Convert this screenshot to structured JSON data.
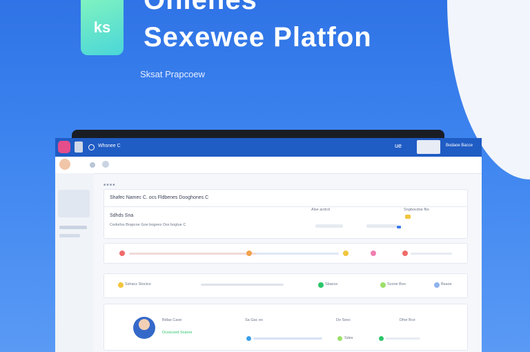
{
  "hero": {
    "logo_text": "ks",
    "title_line1": "Onlenes",
    "title_line2": "Sexewee Platfon",
    "tagline": "Sksat Prapcoew"
  },
  "app": {
    "window_title": "Whsnee C",
    "header_right": "ue",
    "header_stat": "Bodaoe Bacce",
    "panel_header": "Shafec Namec C. ocs Fldbenes Dooghones C",
    "row1_label": "Sdhds Sna",
    "row1_sub": "Cedorlss Brapcoe Goe bogees Oss bogtue C",
    "row1_mid": "Alse acdcd",
    "row1_right": "Sngbocdoe fbs",
    "filter_label": "Sshacs Stoctce",
    "status_a": "Sbacce",
    "status_b": "Scone Boo",
    "status_c": "Bsaoe",
    "profile_name": "Bdlas Caoe",
    "profile_sub": "Dcoscoed Scaroe",
    "profile_col1": "Sa Gac eo",
    "profile_col2": "Do Seec",
    "profile_col3": "Dfoe Bce",
    "profile_tag": "Sdes"
  },
  "colors": {
    "accent_blue": "#1f5cc4",
    "logo_gradient_start": "#7ff2c0",
    "logo_gradient_end": "#4ad6d8",
    "green": "#2bc66a",
    "yellow": "#f2c53d",
    "red": "#f06a6a"
  }
}
